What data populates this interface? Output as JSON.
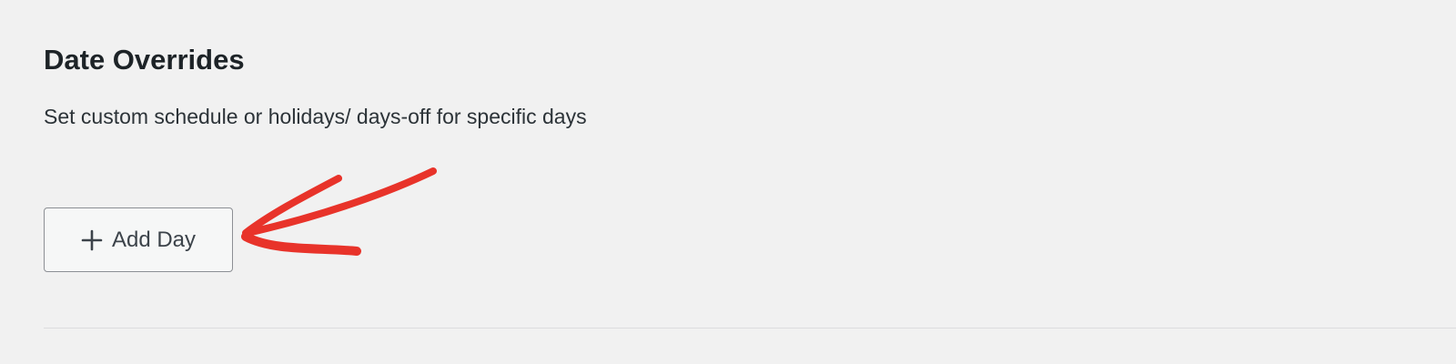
{
  "date_overrides": {
    "title": "Date Overrides",
    "description": "Set custom schedule or holidays/ days-off for specific days",
    "add_day_button": {
      "label": "Add Day",
      "icon": "plus-icon"
    }
  },
  "annotation": {
    "color": "#e8332a",
    "icon": "arrow-left-icon"
  }
}
